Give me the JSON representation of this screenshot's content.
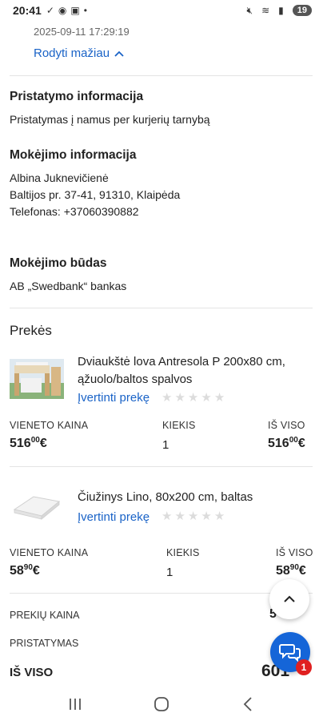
{
  "status_bar": {
    "time": "20:41",
    "battery": "19"
  },
  "order": {
    "timestamp": "2025-09-11 17:29:19",
    "show_less_label": "Rodyti mažiau"
  },
  "delivery": {
    "heading": "Pristatymo informacija",
    "text": "Pristatymas į namus per kurjerių tarnybą"
  },
  "payment_info": {
    "heading": "Mokėjimo informacija",
    "name": "Albina Juknevičienė",
    "address": "Baltijos pr. 37-41, 91310, Klaipėda",
    "phone": "Telefonas: +37060390882"
  },
  "payment_method": {
    "heading": "Mokėjimo būdas",
    "text": "AB „Swedbank“ bankas"
  },
  "products": {
    "heading": "Prekės",
    "rate_label": "Įvertinti prekę",
    "col_unit_price": "VIENETO KAINA",
    "col_qty": "KIEKIS",
    "col_total": "IŠ VISO",
    "items": [
      {
        "name": "Dviaukštė lova Antresola P 200x80 cm, ąžuolo/baltos spalvos",
        "unit_main": "516",
        "unit_cents": "00",
        "qty": "1",
        "total_main": "516",
        "total_cents": "00",
        "currency": "€",
        "rating": 0
      },
      {
        "name": "Čiužinys Lino, 80x200 cm, baltas",
        "unit_main": "58",
        "unit_cents": "90",
        "qty": "1",
        "total_main": "58",
        "total_cents": "90",
        "currency": "€",
        "rating": 0
      }
    ]
  },
  "summary": {
    "items_price_label": "PREKIŲ KAINA",
    "items_price_partial": "5",
    "shipping_label": "PRISTATYMAS",
    "total_label": "IŠ VISO",
    "total_partial": "601"
  },
  "chat": {
    "badge": "1"
  },
  "colors": {
    "link": "#1a63c7",
    "chat_button": "#1565d8",
    "badge": "#e02020"
  }
}
